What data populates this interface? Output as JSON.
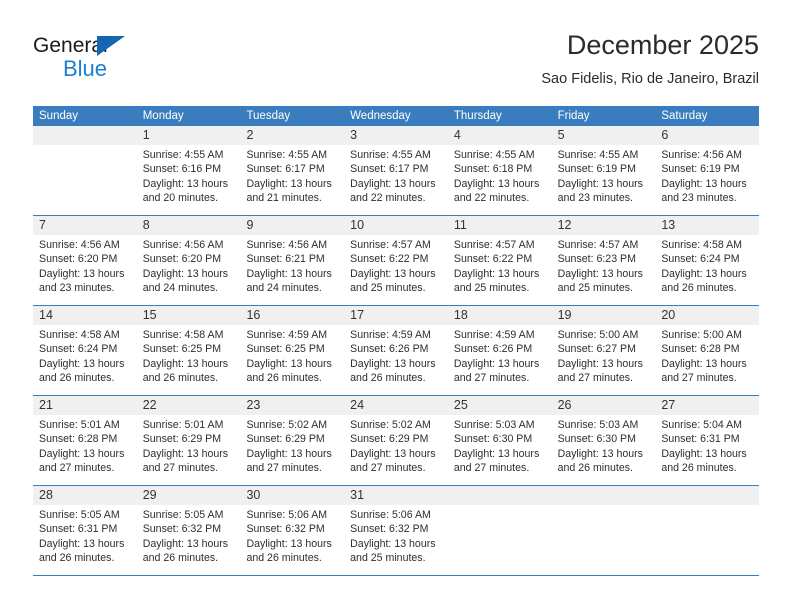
{
  "brand": {
    "name_part1": "General",
    "name_part2": "Blue"
  },
  "header": {
    "title": "December 2025",
    "subtitle": "Sao Fidelis, Rio de Janeiro, Brazil"
  },
  "colors": {
    "header_blue": "#3a7dbf",
    "logo_blue": "#1b7ed6",
    "daynum_band": "#f0f0f0"
  },
  "weekdays": [
    "Sunday",
    "Monday",
    "Tuesday",
    "Wednesday",
    "Thursday",
    "Friday",
    "Saturday"
  ],
  "weeks": [
    [
      {
        "day": "",
        "lines": []
      },
      {
        "day": "1",
        "lines": [
          "Sunrise: 4:55 AM",
          "Sunset: 6:16 PM",
          "Daylight: 13 hours",
          "and 20 minutes."
        ]
      },
      {
        "day": "2",
        "lines": [
          "Sunrise: 4:55 AM",
          "Sunset: 6:17 PM",
          "Daylight: 13 hours",
          "and 21 minutes."
        ]
      },
      {
        "day": "3",
        "lines": [
          "Sunrise: 4:55 AM",
          "Sunset: 6:17 PM",
          "Daylight: 13 hours",
          "and 22 minutes."
        ]
      },
      {
        "day": "4",
        "lines": [
          "Sunrise: 4:55 AM",
          "Sunset: 6:18 PM",
          "Daylight: 13 hours",
          "and 22 minutes."
        ]
      },
      {
        "day": "5",
        "lines": [
          "Sunrise: 4:55 AM",
          "Sunset: 6:19 PM",
          "Daylight: 13 hours",
          "and 23 minutes."
        ]
      },
      {
        "day": "6",
        "lines": [
          "Sunrise: 4:56 AM",
          "Sunset: 6:19 PM",
          "Daylight: 13 hours",
          "and 23 minutes."
        ]
      }
    ],
    [
      {
        "day": "7",
        "lines": [
          "Sunrise: 4:56 AM",
          "Sunset: 6:20 PM",
          "Daylight: 13 hours",
          "and 23 minutes."
        ]
      },
      {
        "day": "8",
        "lines": [
          "Sunrise: 4:56 AM",
          "Sunset: 6:20 PM",
          "Daylight: 13 hours",
          "and 24 minutes."
        ]
      },
      {
        "day": "9",
        "lines": [
          "Sunrise: 4:56 AM",
          "Sunset: 6:21 PM",
          "Daylight: 13 hours",
          "and 24 minutes."
        ]
      },
      {
        "day": "10",
        "lines": [
          "Sunrise: 4:57 AM",
          "Sunset: 6:22 PM",
          "Daylight: 13 hours",
          "and 25 minutes."
        ]
      },
      {
        "day": "11",
        "lines": [
          "Sunrise: 4:57 AM",
          "Sunset: 6:22 PM",
          "Daylight: 13 hours",
          "and 25 minutes."
        ]
      },
      {
        "day": "12",
        "lines": [
          "Sunrise: 4:57 AM",
          "Sunset: 6:23 PM",
          "Daylight: 13 hours",
          "and 25 minutes."
        ]
      },
      {
        "day": "13",
        "lines": [
          "Sunrise: 4:58 AM",
          "Sunset: 6:24 PM",
          "Daylight: 13 hours",
          "and 26 minutes."
        ]
      }
    ],
    [
      {
        "day": "14",
        "lines": [
          "Sunrise: 4:58 AM",
          "Sunset: 6:24 PM",
          "Daylight: 13 hours",
          "and 26 minutes."
        ]
      },
      {
        "day": "15",
        "lines": [
          "Sunrise: 4:58 AM",
          "Sunset: 6:25 PM",
          "Daylight: 13 hours",
          "and 26 minutes."
        ]
      },
      {
        "day": "16",
        "lines": [
          "Sunrise: 4:59 AM",
          "Sunset: 6:25 PM",
          "Daylight: 13 hours",
          "and 26 minutes."
        ]
      },
      {
        "day": "17",
        "lines": [
          "Sunrise: 4:59 AM",
          "Sunset: 6:26 PM",
          "Daylight: 13 hours",
          "and 26 minutes."
        ]
      },
      {
        "day": "18",
        "lines": [
          "Sunrise: 4:59 AM",
          "Sunset: 6:26 PM",
          "Daylight: 13 hours",
          "and 27 minutes."
        ]
      },
      {
        "day": "19",
        "lines": [
          "Sunrise: 5:00 AM",
          "Sunset: 6:27 PM",
          "Daylight: 13 hours",
          "and 27 minutes."
        ]
      },
      {
        "day": "20",
        "lines": [
          "Sunrise: 5:00 AM",
          "Sunset: 6:28 PM",
          "Daylight: 13 hours",
          "and 27 minutes."
        ]
      }
    ],
    [
      {
        "day": "21",
        "lines": [
          "Sunrise: 5:01 AM",
          "Sunset: 6:28 PM",
          "Daylight: 13 hours",
          "and 27 minutes."
        ]
      },
      {
        "day": "22",
        "lines": [
          "Sunrise: 5:01 AM",
          "Sunset: 6:29 PM",
          "Daylight: 13 hours",
          "and 27 minutes."
        ]
      },
      {
        "day": "23",
        "lines": [
          "Sunrise: 5:02 AM",
          "Sunset: 6:29 PM",
          "Daylight: 13 hours",
          "and 27 minutes."
        ]
      },
      {
        "day": "24",
        "lines": [
          "Sunrise: 5:02 AM",
          "Sunset: 6:29 PM",
          "Daylight: 13 hours",
          "and 27 minutes."
        ]
      },
      {
        "day": "25",
        "lines": [
          "Sunrise: 5:03 AM",
          "Sunset: 6:30 PM",
          "Daylight: 13 hours",
          "and 27 minutes."
        ]
      },
      {
        "day": "26",
        "lines": [
          "Sunrise: 5:03 AM",
          "Sunset: 6:30 PM",
          "Daylight: 13 hours",
          "and 26 minutes."
        ]
      },
      {
        "day": "27",
        "lines": [
          "Sunrise: 5:04 AM",
          "Sunset: 6:31 PM",
          "Daylight: 13 hours",
          "and 26 minutes."
        ]
      }
    ],
    [
      {
        "day": "28",
        "lines": [
          "Sunrise: 5:05 AM",
          "Sunset: 6:31 PM",
          "Daylight: 13 hours",
          "and 26 minutes."
        ]
      },
      {
        "day": "29",
        "lines": [
          "Sunrise: 5:05 AM",
          "Sunset: 6:32 PM",
          "Daylight: 13 hours",
          "and 26 minutes."
        ]
      },
      {
        "day": "30",
        "lines": [
          "Sunrise: 5:06 AM",
          "Sunset: 6:32 PM",
          "Daylight: 13 hours",
          "and 26 minutes."
        ]
      },
      {
        "day": "31",
        "lines": [
          "Sunrise: 5:06 AM",
          "Sunset: 6:32 PM",
          "Daylight: 13 hours",
          "and 25 minutes."
        ]
      },
      {
        "day": "",
        "lines": []
      },
      {
        "day": "",
        "lines": []
      },
      {
        "day": "",
        "lines": []
      }
    ]
  ]
}
